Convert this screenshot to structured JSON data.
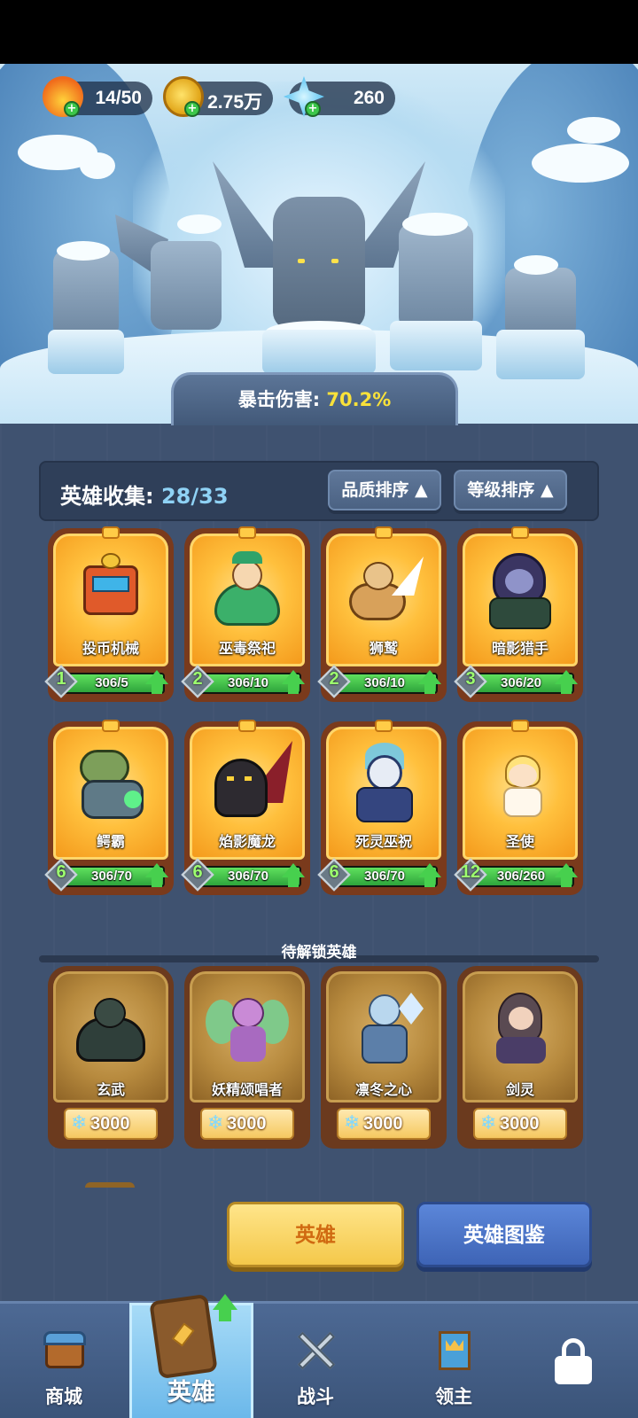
{
  "resources": [
    {
      "icon": "flame-icon",
      "value": "14/50"
    },
    {
      "icon": "gold-coin-icon",
      "value": "2.75万"
    },
    {
      "icon": "ice-crystal-icon",
      "value": "260"
    }
  ],
  "crit": {
    "label": "暴击伤害:",
    "value": "70.2%"
  },
  "collection": {
    "label": "英雄收集:",
    "count": "28/33"
  },
  "sort": {
    "quality": "品质排序",
    "level": "等级排序",
    "arrow": "▲"
  },
  "heroes": [
    {
      "name": "投币机械",
      "level": "1",
      "progress": "306/5",
      "fill": 1.0
    },
    {
      "name": "巫毒祭祀",
      "level": "2",
      "progress": "306/10",
      "fill": 1.0
    },
    {
      "name": "狮鹫",
      "level": "2",
      "progress": "306/10",
      "fill": 1.0
    },
    {
      "name": "暗影猎手",
      "level": "3",
      "progress": "306/20",
      "fill": 1.0
    },
    {
      "name": "鳄霸",
      "level": "6",
      "progress": "306/70",
      "fill": 1.0
    },
    {
      "name": "焰影魔龙",
      "level": "6",
      "progress": "306/70",
      "fill": 1.0
    },
    {
      "name": "死灵巫祝",
      "level": "6",
      "progress": "306/70",
      "fill": 1.0
    },
    {
      "name": "圣使",
      "level": "12",
      "progress": "306/260",
      "fill": 1.0
    }
  ],
  "locked_title": "待解锁英雄",
  "locked_heroes": [
    {
      "name": "玄武",
      "cost": "3000"
    },
    {
      "name": "妖精颂唱者",
      "cost": "3000"
    },
    {
      "name": "凛冬之心",
      "cost": "3000"
    },
    {
      "name": "剑灵",
      "cost": "3000"
    }
  ],
  "buttons": {
    "hero": "英雄",
    "book": "英雄图鉴"
  },
  "nav": [
    {
      "label": "商城",
      "icon": "shop-chest-icon"
    },
    {
      "label": "英雄",
      "icon": "hero-card-icon",
      "selected": true
    },
    {
      "label": "战斗",
      "icon": "crossed-swords-icon"
    },
    {
      "label": "领主",
      "icon": "lord-banner-icon"
    },
    {
      "label": "",
      "icon": "lock-icon"
    }
  ],
  "colors": {
    "accent_yellow": "#f9e13a",
    "collect_count": "#8fd2f5",
    "level_green": "#9dff6f",
    "progress_green": "#47d04e"
  }
}
